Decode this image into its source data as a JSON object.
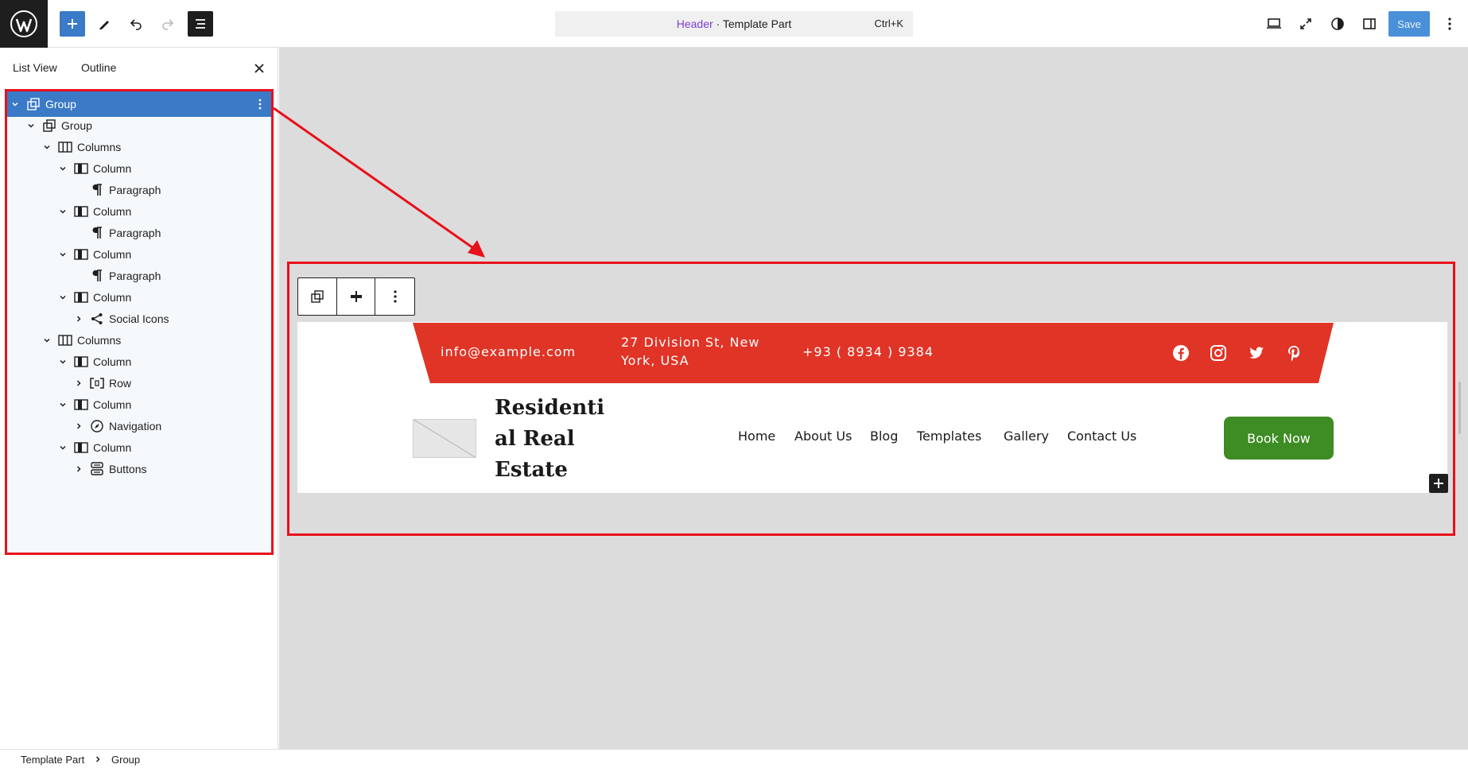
{
  "topbar": {
    "command": {
      "accent": "Header",
      "sep": " · ",
      "rest": "Template Part",
      "shortcut": "Ctrl+K"
    },
    "save_label": "Save"
  },
  "sidebar": {
    "tabs": [
      "List View",
      "Outline"
    ],
    "tree": [
      {
        "label": "Group",
        "icon": "group-icon"
      },
      {
        "label": "Group",
        "icon": "group-icon"
      },
      {
        "label": "Columns",
        "icon": "columns-icon"
      },
      {
        "label": "Column",
        "icon": "column-icon"
      },
      {
        "label": "Paragraph",
        "icon": "paragraph-icon"
      },
      {
        "label": "Column",
        "icon": "column-icon"
      },
      {
        "label": "Paragraph",
        "icon": "paragraph-icon"
      },
      {
        "label": "Column",
        "icon": "column-icon"
      },
      {
        "label": "Paragraph",
        "icon": "paragraph-icon"
      },
      {
        "label": "Column",
        "icon": "column-icon"
      },
      {
        "label": "Social Icons",
        "icon": "share-icon"
      },
      {
        "label": "Columns",
        "icon": "columns-icon"
      },
      {
        "label": "Column",
        "icon": "column-icon"
      },
      {
        "label": "Row",
        "icon": "row-icon"
      },
      {
        "label": "Column",
        "icon": "column-icon"
      },
      {
        "label": "Navigation",
        "icon": "navigation-icon"
      },
      {
        "label": "Column",
        "icon": "column-icon"
      },
      {
        "label": "Buttons",
        "icon": "buttons-icon"
      }
    ]
  },
  "breadcrumb": [
    "Template Part",
    "Group"
  ],
  "header_preview": {
    "email": "info@example.com",
    "address_line1": "27 Division St, New",
    "address_line2": "York, USA",
    "phone": "+93 ( 8934 ) 9384",
    "social": [
      "facebook-icon",
      "instagram-icon",
      "twitter-icon",
      "pinterest-icon"
    ],
    "title_lines": [
      "Residenti",
      "al Real",
      "Estate"
    ],
    "nav": [
      "Home",
      "About Us",
      "Blog",
      "Templates",
      "Gallery",
      "Contact Us"
    ],
    "cta": "Book Now"
  },
  "colors": {
    "accent_blue": "#3a7ac6",
    "strip_red": "#e03426",
    "cta_green": "#3e8c24",
    "annotation_red": "#e8101a"
  }
}
